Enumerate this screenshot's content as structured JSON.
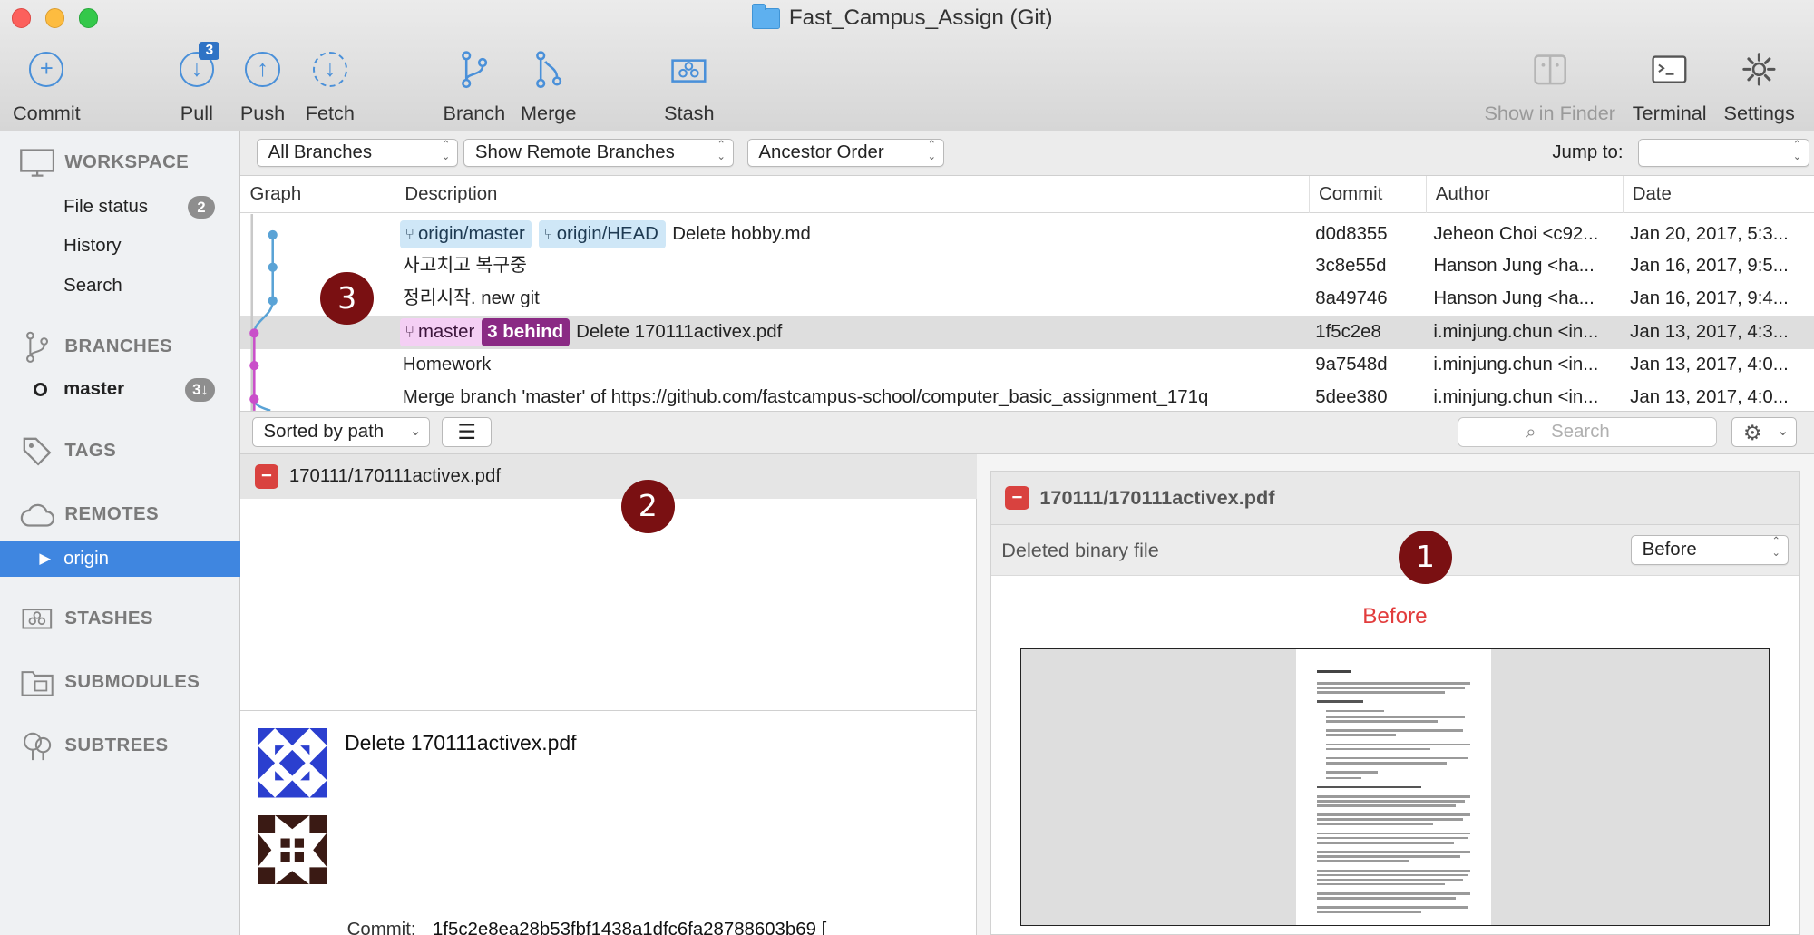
{
  "window": {
    "title": "Fast_Campus_Assign (Git)"
  },
  "toolbar": {
    "commit": "Commit",
    "pull": "Pull",
    "pull_badge": "3",
    "push": "Push",
    "fetch": "Fetch",
    "branch": "Branch",
    "merge": "Merge",
    "stash": "Stash",
    "show_in_finder": "Show in Finder",
    "terminal": "Terminal",
    "settings": "Settings"
  },
  "sidebar": {
    "workspace": "WORKSPACE",
    "file_status": "File status",
    "file_status_count": "2",
    "history": "History",
    "search": "Search",
    "branches": "BRANCHES",
    "master": "master",
    "master_count": "3↓",
    "tags": "TAGS",
    "remotes": "REMOTES",
    "origin": "origin",
    "stashes": "STASHES",
    "submodules": "SUBMODULES",
    "subtrees": "SUBTREES"
  },
  "filters": {
    "branches": "All Branches",
    "remote": "Show Remote Branches",
    "order": "Ancestor Order",
    "jump_to": "Jump to:",
    "jump_value": ""
  },
  "columns": {
    "graph": "Graph",
    "description": "Description",
    "commit": "Commit",
    "author": "Author",
    "date": "Date"
  },
  "commits": [
    {
      "tags": [
        "origin/master",
        "origin/HEAD"
      ],
      "description": "Delete hobby.md",
      "commit": "d0d8355",
      "author": "Jeheon Choi <c92...",
      "date": "Jan 20, 2017, 5:3..."
    },
    {
      "description": "사고치고 복구중",
      "commit": "3c8e55d",
      "author": "Hanson Jung <ha...",
      "date": "Jan 16, 2017, 9:5..."
    },
    {
      "description": "정리시작. new git",
      "commit": "8a49746",
      "author": "Hanson Jung <ha...",
      "date": "Jan 16, 2017, 9:4..."
    },
    {
      "tag_local": "master",
      "tag_behind": "3 behind",
      "description": "Delete 170111activex.pdf",
      "commit": "1f5c2e8",
      "author": "i.minjung.chun <in...",
      "date": "Jan 13, 2017, 4:3..."
    },
    {
      "description": "Homework",
      "commit": "9a7548d",
      "author": "i.minjung.chun <in...",
      "date": "Jan 13, 2017, 4:0..."
    },
    {
      "description": "Merge branch 'master' of https://github.com/fastcampus-school/computer_basic_assignment_171q",
      "commit": "5dee380",
      "author": "i.minjung.chun <in...",
      "date": "Jan 13, 2017, 4:0..."
    }
  ],
  "files": {
    "sort": "Sorted by path",
    "search_placeholder": "Search",
    "items": [
      {
        "path": "170111/170111activex.pdf",
        "status": "removed"
      }
    ]
  },
  "detail": {
    "message": "Delete 170111activex.pdf",
    "commit_label": "Commit:",
    "commit_hash": "1f5c2e8ea28b53fbf1438a1dfc6fa28788603b69 ["
  },
  "diff": {
    "file": "170111/170111activex.pdf",
    "status": "Deleted binary file",
    "mode": "Before",
    "preview_label": "Before"
  },
  "markers": [
    "1",
    "2",
    "3"
  ],
  "colors": {
    "remote_tag": "#cfe7f7",
    "local_tag": "#f4cff4",
    "behind_tag": "#8a2a84",
    "selection": "#3f86e0",
    "removed": "#d9423f",
    "marker": "#7a1012"
  }
}
